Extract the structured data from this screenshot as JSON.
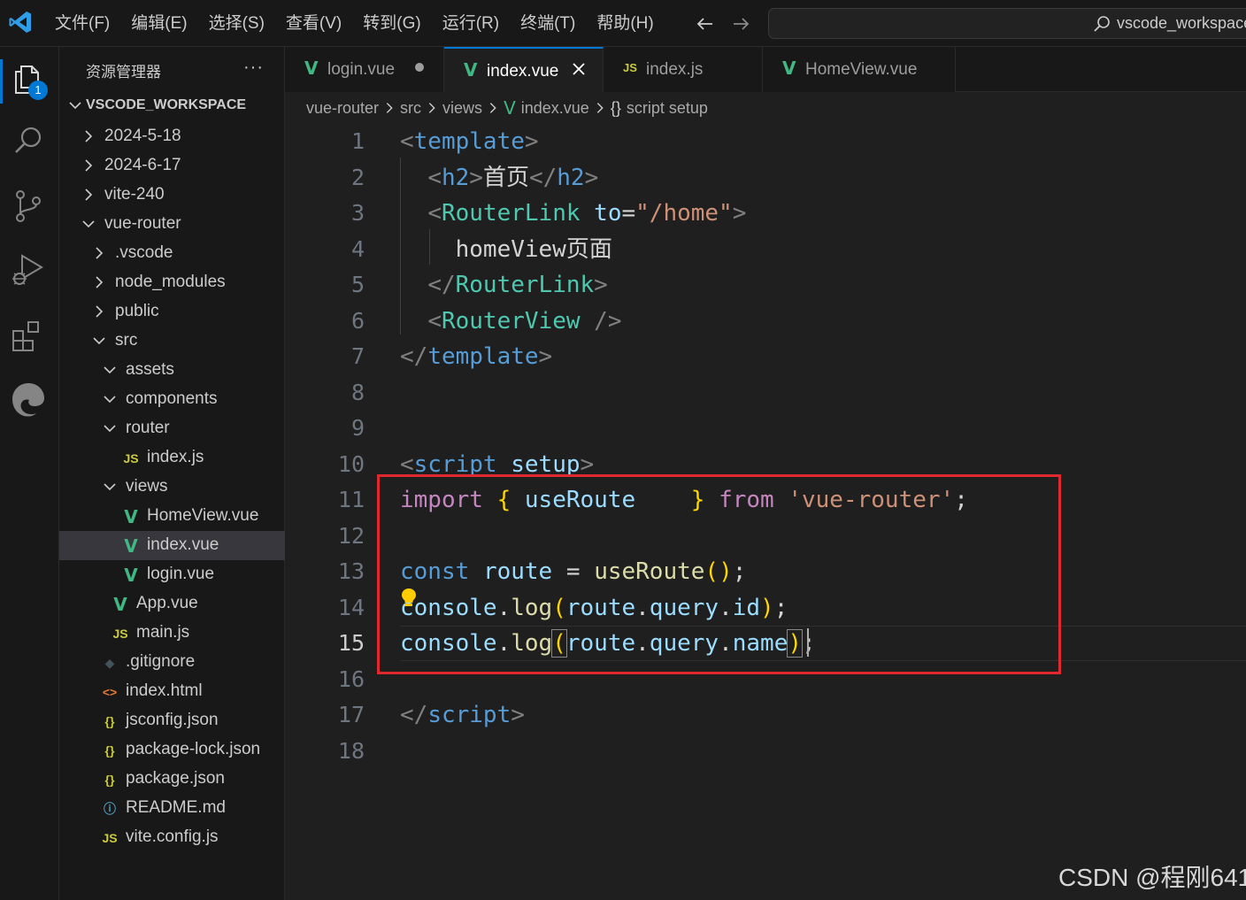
{
  "titlebar": {
    "menu": [
      "文件(F)",
      "编辑(E)",
      "选择(S)",
      "查看(V)",
      "转到(G)",
      "运行(R)",
      "终端(T)",
      "帮助(H)"
    ],
    "command_center": "vscode_workspace"
  },
  "activitybar": {
    "explorer_badge": "1"
  },
  "sidebar": {
    "title": "资源管理器",
    "more": "···",
    "root_label": "VSCODE_WORKSPACE",
    "tree": [
      {
        "name": "2024-5-18",
        "type": "folder",
        "open": false,
        "depth": 0
      },
      {
        "name": "2024-6-17",
        "type": "folder",
        "open": false,
        "depth": 0
      },
      {
        "name": "vite-240",
        "type": "folder",
        "open": false,
        "depth": 0
      },
      {
        "name": "vue-router",
        "type": "folder",
        "open": true,
        "depth": 0
      },
      {
        "name": ".vscode",
        "type": "folder",
        "open": false,
        "depth": 1
      },
      {
        "name": "node_modules",
        "type": "folder",
        "open": false,
        "depth": 1
      },
      {
        "name": "public",
        "type": "folder",
        "open": false,
        "depth": 1
      },
      {
        "name": "src",
        "type": "folder",
        "open": true,
        "depth": 1
      },
      {
        "name": "assets",
        "type": "folder",
        "open": true,
        "depth": 2
      },
      {
        "name": "components",
        "type": "folder",
        "open": true,
        "depth": 2
      },
      {
        "name": "router",
        "type": "folder",
        "open": true,
        "depth": 2
      },
      {
        "name": "index.js",
        "type": "js",
        "depth": 3
      },
      {
        "name": "views",
        "type": "folder",
        "open": true,
        "depth": 2
      },
      {
        "name": "HomeView.vue",
        "type": "vue",
        "depth": 3
      },
      {
        "name": "index.vue",
        "type": "vue",
        "depth": 3,
        "selected": true
      },
      {
        "name": "login.vue",
        "type": "vue",
        "depth": 3
      },
      {
        "name": "App.vue",
        "type": "vue",
        "depth": 2
      },
      {
        "name": "main.js",
        "type": "js",
        "depth": 2
      },
      {
        "name": ".gitignore",
        "type": "git",
        "depth": 1
      },
      {
        "name": "index.html",
        "type": "html",
        "depth": 1
      },
      {
        "name": "jsconfig.json",
        "type": "json",
        "depth": 1
      },
      {
        "name": "package-lock.json",
        "type": "json",
        "depth": 1
      },
      {
        "name": "package.json",
        "type": "json",
        "depth": 1
      },
      {
        "name": "README.md",
        "type": "info",
        "depth": 1
      },
      {
        "name": "vite.config.js",
        "type": "js",
        "depth": 1
      }
    ]
  },
  "tabs": [
    {
      "label": "login.vue",
      "type": "vue",
      "dirty": true,
      "active": false
    },
    {
      "label": "index.vue",
      "type": "vue",
      "dirty": false,
      "active": true
    },
    {
      "label": "index.js",
      "type": "js",
      "dirty": false,
      "active": false
    },
    {
      "label": "HomeView.vue",
      "type": "vue",
      "dirty": false,
      "active": false
    }
  ],
  "breadcrumb": [
    "vue-router",
    "src",
    "views",
    "index.vue",
    "script setup"
  ],
  "icons": {
    "vue_glyph": "V",
    "js_glyph": "JS",
    "json_glyph": "{}",
    "html_glyph": "<>",
    "info_glyph": "ⓘ",
    "git_glyph": "◆",
    "scope_glyph": "{}"
  },
  "editor": {
    "current_line": 15,
    "line_numbers": [
      "1",
      "2",
      "3",
      "4",
      "5",
      "6",
      "7",
      "8",
      "9",
      "10",
      "11",
      "12",
      "13",
      "14",
      "15",
      "16",
      "17",
      "18"
    ],
    "lines": [
      [
        [
          "t-punc",
          "<"
        ],
        [
          "t-tag",
          "template"
        ],
        [
          "t-punc",
          ">"
        ]
      ],
      [
        [
          "t-white",
          "  "
        ],
        [
          "t-punc",
          "<"
        ],
        [
          "t-tag",
          "h2"
        ],
        [
          "t-punc",
          ">"
        ],
        [
          "t-white",
          "首页"
        ],
        [
          "t-punc",
          "</"
        ],
        [
          "t-tag",
          "h2"
        ],
        [
          "t-punc",
          ">"
        ]
      ],
      [
        [
          "t-white",
          "  "
        ],
        [
          "t-punc",
          "<"
        ],
        [
          "t-comp",
          "RouterLink"
        ],
        [
          "t-white",
          " "
        ],
        [
          "t-attr",
          "to"
        ],
        [
          "t-white",
          "="
        ],
        [
          "t-str",
          "\"/home\""
        ],
        [
          "t-punc",
          ">"
        ]
      ],
      [
        [
          "t-white",
          "    homeView页面"
        ]
      ],
      [
        [
          "t-white",
          "  "
        ],
        [
          "t-punc",
          "</"
        ],
        [
          "t-comp",
          "RouterLink"
        ],
        [
          "t-punc",
          ">"
        ]
      ],
      [
        [
          "t-white",
          "  "
        ],
        [
          "t-punc",
          "<"
        ],
        [
          "t-comp",
          "RouterView"
        ],
        [
          "t-white",
          " "
        ],
        [
          "t-punc",
          "/>"
        ]
      ],
      [
        [
          "t-punc",
          "</"
        ],
        [
          "t-tag",
          "template"
        ],
        [
          "t-punc",
          ">"
        ]
      ],
      [],
      [],
      [
        [
          "t-punc",
          "<"
        ],
        [
          "t-tag",
          "script"
        ],
        [
          "t-white",
          " "
        ],
        [
          "t-attr",
          "setup"
        ],
        [
          "t-punc",
          ">"
        ]
      ],
      [
        [
          "t-kw",
          "import"
        ],
        [
          "t-white",
          " "
        ],
        [
          "t-br1",
          "{"
        ],
        [
          "t-white",
          " "
        ],
        [
          "t-var",
          "useRoute"
        ],
        [
          "t-white",
          "    "
        ],
        [
          "t-br1",
          "}"
        ],
        [
          "t-white",
          " "
        ],
        [
          "t-kw",
          "from"
        ],
        [
          "t-white",
          " "
        ],
        [
          "t-str",
          "'vue-router'"
        ],
        [
          "t-white",
          ";"
        ]
      ],
      [],
      [
        [
          "t-decl",
          "const"
        ],
        [
          "t-white",
          " "
        ],
        [
          "t-var",
          "route"
        ],
        [
          "t-white",
          " = "
        ],
        [
          "t-fn",
          "useRoute"
        ],
        [
          "t-br1",
          "()"
        ],
        [
          "t-white",
          ";"
        ]
      ],
      [
        [
          "t-var",
          "console"
        ],
        [
          "t-white",
          "."
        ],
        [
          "t-fn",
          "log"
        ],
        [
          "t-br1",
          "("
        ],
        [
          "t-var",
          "route"
        ],
        [
          "t-white",
          "."
        ],
        [
          "t-var",
          "query"
        ],
        [
          "t-white",
          "."
        ],
        [
          "t-var",
          "id"
        ],
        [
          "t-br1",
          ")"
        ],
        [
          "t-white",
          ";"
        ]
      ],
      [
        [
          "t-var",
          "console"
        ],
        [
          "t-white",
          "."
        ],
        [
          "t-fn",
          "log"
        ],
        [
          "t-br1 bracket-match",
          "("
        ],
        [
          "t-var",
          "route"
        ],
        [
          "t-white",
          "."
        ],
        [
          "t-var",
          "query"
        ],
        [
          "t-white",
          "."
        ],
        [
          "t-var",
          "name"
        ],
        [
          "t-br1 bracket-match",
          ")"
        ],
        [
          "t-white",
          ";"
        ]
      ],
      [],
      [
        [
          "t-punc",
          "</"
        ],
        [
          "t-tag",
          "script"
        ],
        [
          "t-punc",
          ">"
        ]
      ],
      []
    ]
  },
  "colors": {
    "accent": "#0078d4",
    "vue": "#41b883",
    "js": "#cbcb41",
    "json": "#cbcb41",
    "html": "#e37933",
    "info": "#519aba",
    "git": "#41535b",
    "annotation_box": "#e0292f"
  },
  "watermark": "CSDN @程刚641"
}
